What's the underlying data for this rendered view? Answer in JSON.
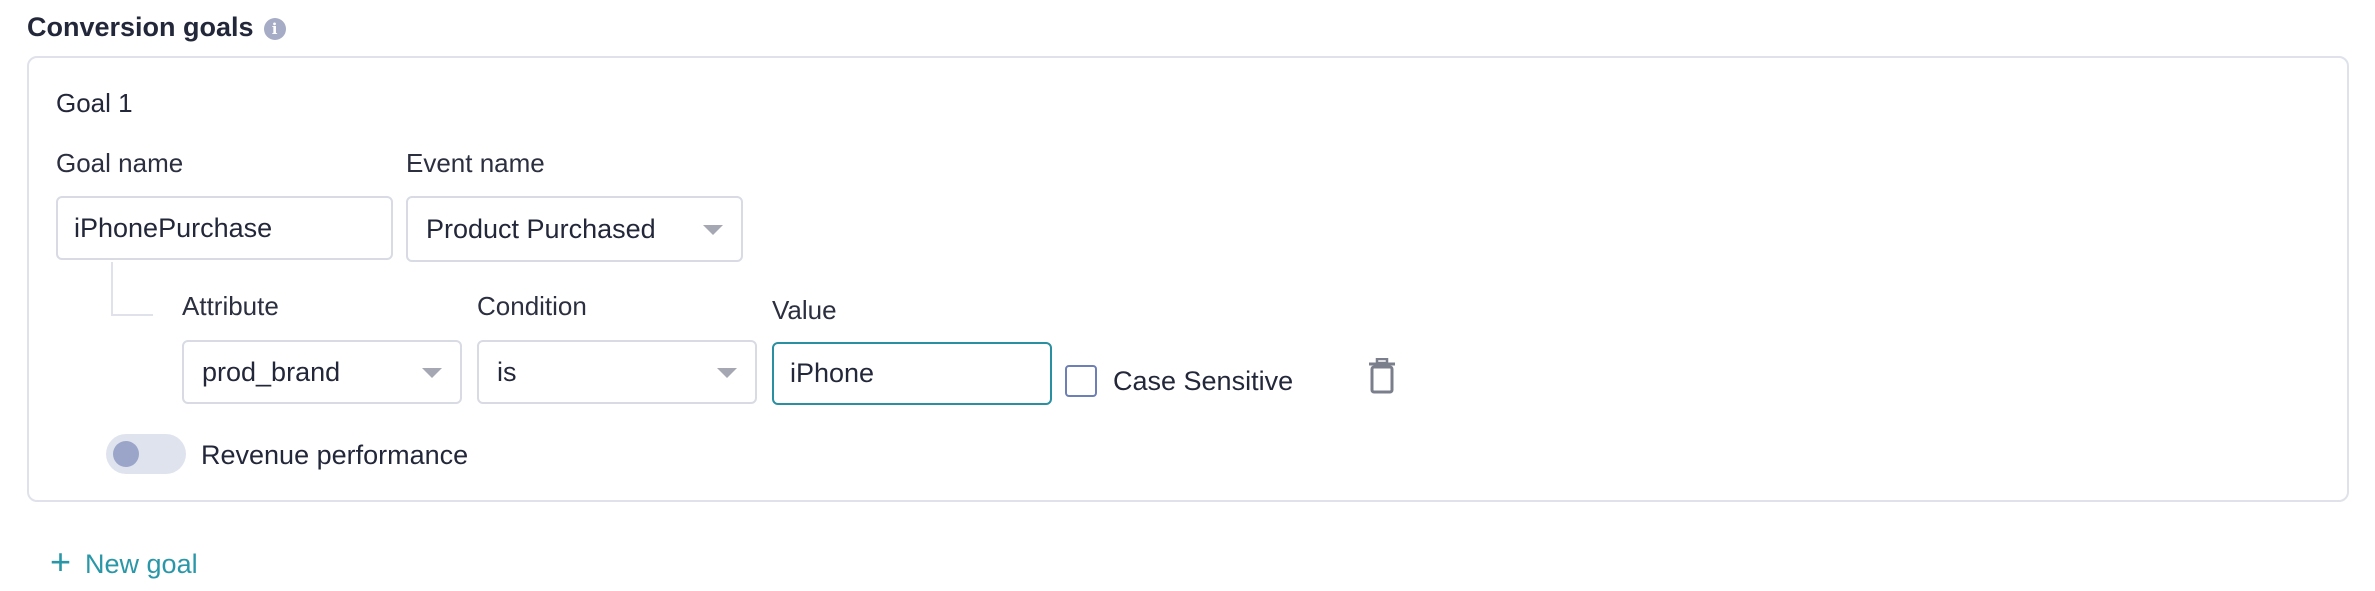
{
  "section": {
    "title": "Conversion goals",
    "info_icon": "info-icon"
  },
  "goal": {
    "heading": "Goal 1",
    "goal_name_label": "Goal name",
    "goal_name_value": "iPhonePurchase",
    "event_name_label": "Event name",
    "event_name_value": "Product Purchased",
    "attribute_label": "Attribute",
    "attribute_value": "prod_brand",
    "condition_label": "Condition",
    "condition_value": "is",
    "value_label": "Value",
    "value_value": "iPhone",
    "case_sensitive_label": "Case Sensitive",
    "case_sensitive_checked": false,
    "revenue_label": "Revenue performance",
    "revenue_enabled": false
  },
  "actions": {
    "new_goal_label": "New goal"
  },
  "colors": {
    "accent": "#2a97a8",
    "focus_border": "#2a8fa0",
    "border": "#d8dbe4",
    "toggle_track": "#dfe3ee",
    "toggle_knob": "#9aa5c9"
  }
}
